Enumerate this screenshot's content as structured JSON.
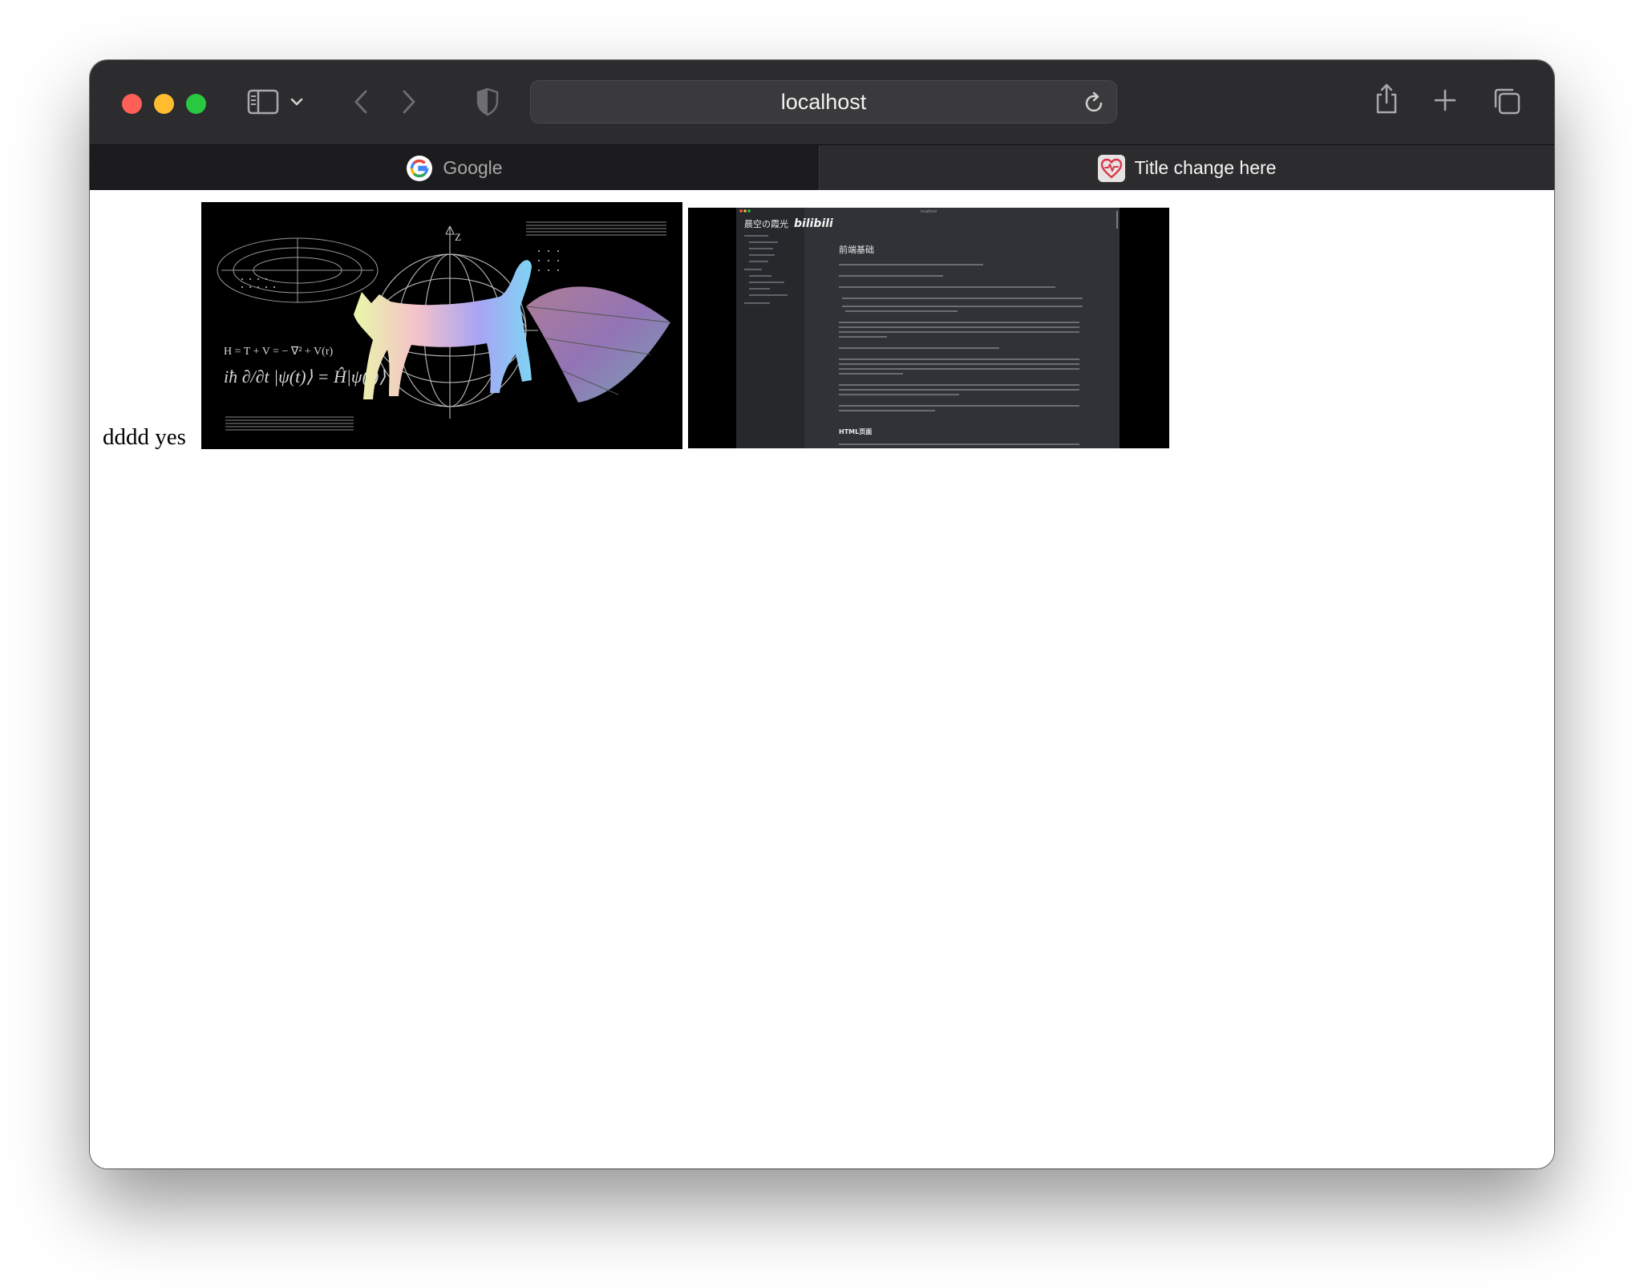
{
  "browser": {
    "url": "localhost",
    "tabs": [
      {
        "title": "Google",
        "active": false
      },
      {
        "title": "Title change here",
        "active": true
      }
    ]
  },
  "page": {
    "inline_text": "dddd yes"
  },
  "images": {
    "left": {
      "description_icon": "cat-physics-image"
    },
    "right": {
      "window_title": "localhost",
      "brand_text": "晨空の霞光",
      "brand_logo": "bilibili",
      "heading": "前端基础",
      "subheading": "HTML页面"
    }
  },
  "colors": {
    "toolbar": "#2c2c2e",
    "tabbar": "#1c1c1e",
    "close": "#fe5f57",
    "minimize": "#febc2e",
    "zoom": "#28c840"
  }
}
